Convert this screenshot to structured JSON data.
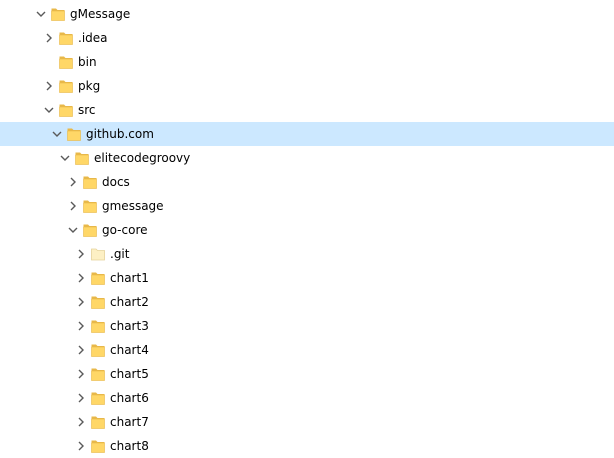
{
  "tree": {
    "items": [
      {
        "label": "gMessage",
        "state": "expanded",
        "level": 0,
        "icon": "folder-icon",
        "selected": false
      },
      {
        "label": ".idea",
        "state": "collapsed",
        "level": 1,
        "icon": "folder-icon",
        "selected": false
      },
      {
        "label": "bin",
        "state": "none",
        "level": 1,
        "icon": "folder-icon",
        "selected": false
      },
      {
        "label": "pkg",
        "state": "collapsed",
        "level": 1,
        "icon": "folder-icon",
        "selected": false
      },
      {
        "label": "src",
        "state": "expanded",
        "level": 1,
        "icon": "folder-icon",
        "selected": false
      },
      {
        "label": "github.com",
        "state": "expanded",
        "level": 2,
        "icon": "folder-icon",
        "selected": true
      },
      {
        "label": "elitecodegroovy",
        "state": "expanded",
        "level": 3,
        "icon": "folder-icon",
        "selected": false
      },
      {
        "label": "docs",
        "state": "collapsed",
        "level": 4,
        "icon": "folder-icon",
        "selected": false
      },
      {
        "label": "gmessage",
        "state": "collapsed",
        "level": 4,
        "icon": "folder-icon",
        "selected": false
      },
      {
        "label": "go-core",
        "state": "expanded",
        "level": 4,
        "icon": "folder-icon",
        "selected": false
      },
      {
        "label": ".git",
        "state": "collapsed",
        "level": 5,
        "icon": "hidden-folder-icon",
        "selected": false
      },
      {
        "label": "chart1",
        "state": "collapsed",
        "level": 5,
        "icon": "folder-icon",
        "selected": false
      },
      {
        "label": "chart2",
        "state": "collapsed",
        "level": 5,
        "icon": "folder-icon",
        "selected": false
      },
      {
        "label": "chart3",
        "state": "collapsed",
        "level": 5,
        "icon": "folder-icon",
        "selected": false
      },
      {
        "label": "chart4",
        "state": "collapsed",
        "level": 5,
        "icon": "folder-icon",
        "selected": false
      },
      {
        "label": "chart5",
        "state": "collapsed",
        "level": 5,
        "icon": "folder-icon",
        "selected": false
      },
      {
        "label": "chart6",
        "state": "collapsed",
        "level": 5,
        "icon": "folder-icon",
        "selected": false
      },
      {
        "label": "chart7",
        "state": "collapsed",
        "level": 5,
        "icon": "folder-icon",
        "selected": false
      },
      {
        "label": "chart8",
        "state": "collapsed",
        "level": 5,
        "icon": "folder-icon",
        "selected": false
      }
    ]
  },
  "colors": {
    "selection": "#cce8ff",
    "folder_fill": "#ffd767",
    "folder_back": "#e8b849",
    "hidden_folder_fill": "#fdf0c4",
    "chevron": "#5a5a5a"
  }
}
